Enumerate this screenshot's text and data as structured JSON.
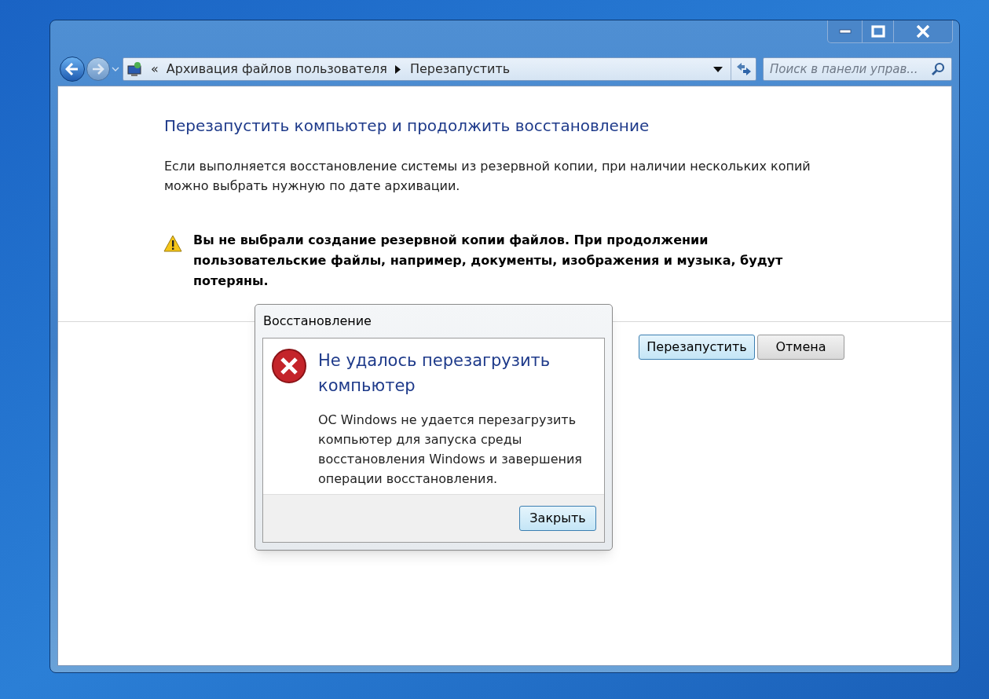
{
  "window": {
    "controls": [
      {
        "kind": "minimize"
      },
      {
        "kind": "maximize"
      },
      {
        "kind": "close"
      }
    ]
  },
  "address_bar": {
    "overflow": "«",
    "crumbs": [
      "Архивация файлов пользователя",
      "Перезапустить"
    ]
  },
  "search": {
    "placeholder": "Поиск в панели управ..."
  },
  "page": {
    "heading": "Перезапустить компьютер и продолжить восстановление",
    "description": "Если выполняется восстановление системы из резервной копии, при наличии нескольких копий можно выбрать нужную по дате архивации.",
    "warning": "Вы не выбрали создание резервной копии файлов. При продолжении пользовательские файлы, например, документы, изображения и музыка, будут потеряны.",
    "buttons": [
      {
        "label": "Перезапустить",
        "default": true
      },
      {
        "label": "Отмена",
        "default": false
      }
    ]
  },
  "dialog": {
    "title": "Восстановление",
    "heading": "Не удалось перезагрузить компьютер",
    "message": "ОС Windows не удается перезагрузить компьютер для запуска среды восстановления Windows и завершения операции восстановления.",
    "buttons": [
      {
        "label": "Закрыть",
        "default": true
      }
    ]
  }
}
